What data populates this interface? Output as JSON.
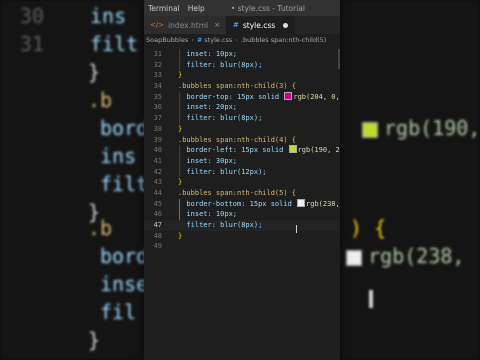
{
  "menubar": {
    "items": [
      "Terminal",
      "Help"
    ],
    "window_title": "• style.css - Tutorial"
  },
  "tabs": [
    {
      "label": "index.html",
      "close": "×",
      "active": false
    },
    {
      "label": "style.css",
      "active": true
    }
  ],
  "breadcrumb": {
    "folder": "SoapBubbles",
    "file": "style.css",
    "selector": ".bubbles span:nth-child(5)"
  },
  "code_lines": [
    {
      "num": "31",
      "text": "  inset: 10px;"
    },
    {
      "num": "32",
      "text": "  filter: blur(8px);"
    },
    {
      "num": "33",
      "text": "}"
    },
    {
      "num": "34",
      "text": ".bubbles span:nth-child(3) {"
    },
    {
      "num": "35",
      "text": "  border-top: 15px solid ",
      "swatch": "#cc0099",
      "rest": "rgb(204, 0,"
    },
    {
      "num": "36",
      "text": "  inset: 20px;"
    },
    {
      "num": "37",
      "text": "  filter: blur(8px);"
    },
    {
      "num": "38",
      "text": "}"
    },
    {
      "num": "39",
      "text": ".bubbles span:nth-child(4) {"
    },
    {
      "num": "40",
      "text": "  border-left: 15px solid ",
      "swatch": "#bedc2d",
      "rest": "rgb(190, 2"
    },
    {
      "num": "41",
      "text": "  inset: 30px;"
    },
    {
      "num": "42",
      "text": "  filter: blur(12px);"
    },
    {
      "num": "43",
      "text": "}"
    },
    {
      "num": "44",
      "text": ".bubbles span:nth-child(5) {"
    },
    {
      "num": "45",
      "text": "  border-bottom: 15px solid ",
      "swatch": "#eeeeee",
      "rest": "rgb(238,"
    },
    {
      "num": "46",
      "text": "  inset: 10px;"
    },
    {
      "num": "47",
      "text": "  filter: blur(8px);"
    },
    {
      "num": "48",
      "text": "}"
    },
    {
      "num": "49",
      "text": ""
    }
  ],
  "background_zoom": [
    {
      "num": "30",
      "text": "ins"
    },
    {
      "num": "31",
      "text": "filt"
    },
    {
      "num": "",
      "text": "}"
    },
    {
      "num": "",
      "text": ".b"
    },
    {
      "num": "",
      "text": "bord"
    },
    {
      "num": "",
      "text": "ins"
    },
    {
      "num": "",
      "text": "filt"
    },
    {
      "num": "",
      "text": "}"
    },
    {
      "num": "",
      "text": ".b"
    },
    {
      "num": "",
      "text": "bord"
    },
    {
      "num": "",
      "text": "inse"
    },
    {
      "num": "",
      "text": "fil"
    },
    {
      "num": "",
      "text": "}"
    }
  ],
  "bg_right": {
    "a": "rgb(190, 2",
    "b": ") {",
    "c": "lid",
    "d": "rgb(238,"
  },
  "colors": {
    "editor_bg": "#1e1e1e",
    "selector": "#d7ba7d",
    "property": "#9cdcfe",
    "number": "#b5cea8"
  }
}
